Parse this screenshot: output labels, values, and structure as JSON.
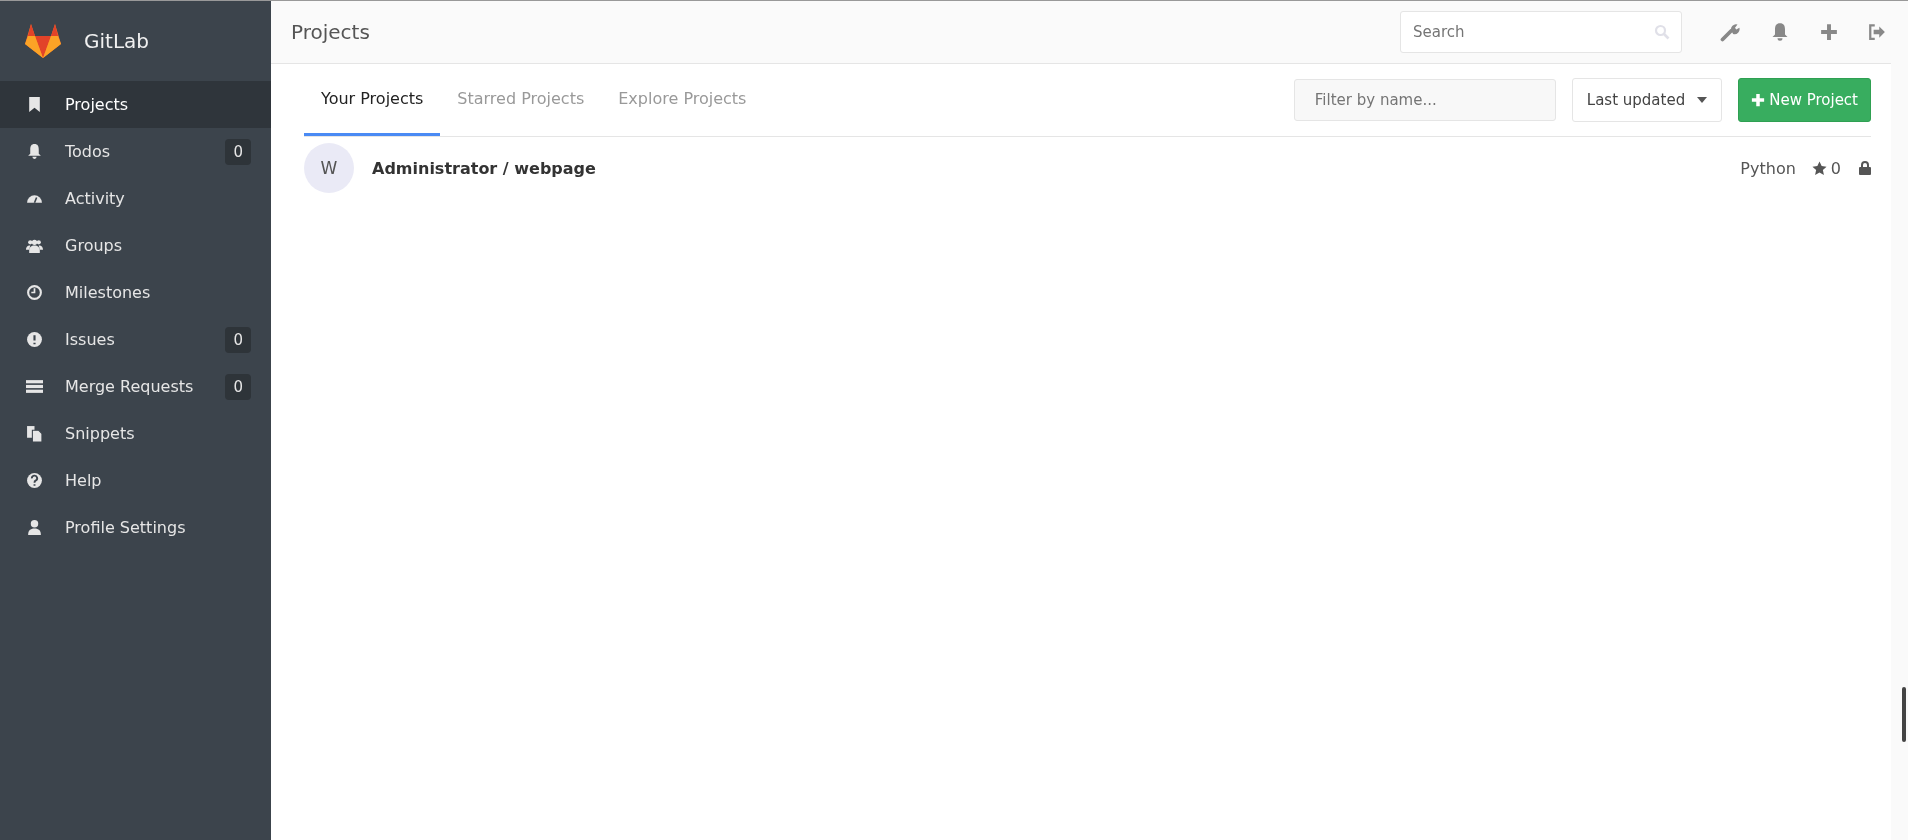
{
  "brand": "GitLab",
  "sidebar": {
    "items": [
      {
        "label": "Projects",
        "selected": true
      },
      {
        "label": "Todos",
        "selected": false,
        "count": "0"
      },
      {
        "label": "Activity",
        "selected": false
      },
      {
        "label": "Groups",
        "selected": false
      },
      {
        "label": "Milestones",
        "selected": false
      },
      {
        "label": "Issues",
        "selected": false,
        "count": "0"
      },
      {
        "label": "Merge Requests",
        "selected": false,
        "count": "0"
      },
      {
        "label": "Snippets",
        "selected": false
      },
      {
        "label": "Help",
        "selected": false
      },
      {
        "label": "Profile Settings",
        "selected": false
      }
    ]
  },
  "header": {
    "title": "Projects",
    "search": {
      "placeholder": "Search"
    }
  },
  "tabs": [
    {
      "label": "Your Projects",
      "selected": true
    },
    {
      "label": "Starred Projects",
      "selected": false
    },
    {
      "label": "Explore Projects",
      "selected": false
    }
  ],
  "filter": {
    "placeholder": "Filter by name..."
  },
  "sort": {
    "value": "Last updated"
  },
  "new_project_button": "New Project",
  "projects": [
    {
      "avatar": "W",
      "name": "Administrator / webpage",
      "language": "Python",
      "stars": "0",
      "private": true
    }
  ]
}
